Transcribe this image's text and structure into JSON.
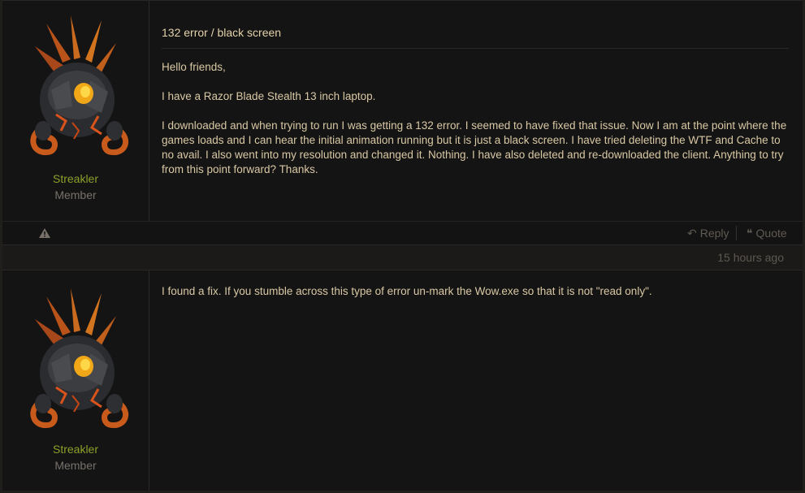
{
  "posts": [
    {
      "author": {
        "name": "Streakler",
        "role": "Member"
      },
      "title": "132 error / black screen",
      "body": [
        "Hello friends,",
        "I have a Razor Blade Stealth 13 inch laptop.",
        "I downloaded and when trying to run I was getting a 132 error. I seemed to have fixed that issue. Now I am at the point where the games loads and I can hear the initial animation running but it is just a black screen. I have tried deleting the WTF and Cache to no avail. I also went into my resolution and changed it. Nothing. I have also deleted and re-downloaded the client. Anything to try from this point forward? Thanks."
      ],
      "actions": {
        "reply": "Reply",
        "quote": "Quote"
      }
    },
    {
      "timestamp": "15 hours ago",
      "author": {
        "name": "Streakler",
        "role": "Member"
      },
      "body": [
        "I found a fix. If you stumble across this type of error un-mark the Wow.exe so that it is not \"read only\"."
      ]
    }
  ],
  "icons": {
    "report": "warning-icon",
    "reply": "reply-arrow-icon",
    "quote": "quote-icon"
  },
  "colors": {
    "author_name": "#8ca12a",
    "body_text": "#d9c8a4",
    "muted": "#5f5a52"
  }
}
